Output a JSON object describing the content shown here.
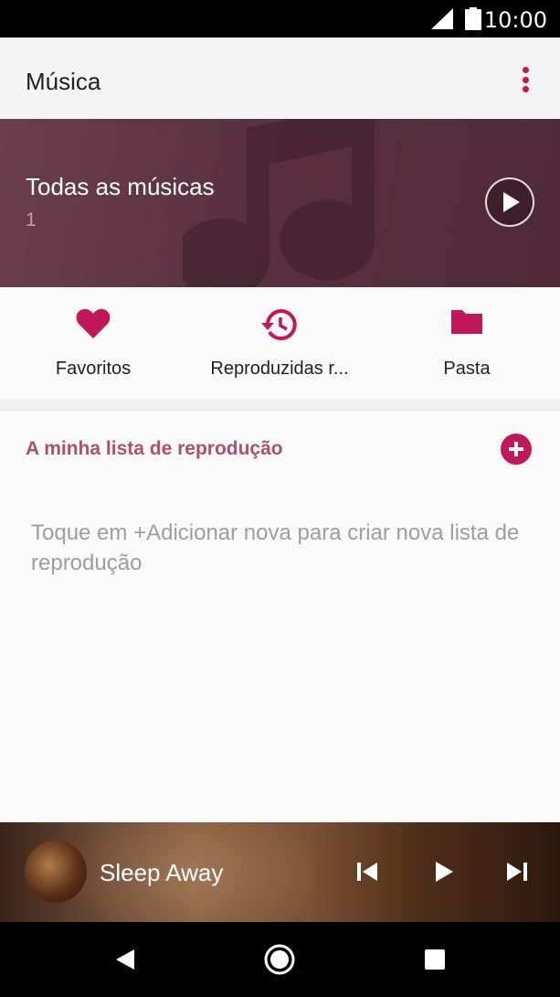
{
  "status_bar": {
    "time": "10:00"
  },
  "app_bar": {
    "title": "Música",
    "menu_icon": "more-vert-icon"
  },
  "hero": {
    "title": "Todas as músicas",
    "count": "1",
    "play_icon": "play-icon"
  },
  "quick_links": [
    {
      "label": "Favoritos",
      "icon": "heart-icon",
      "color": "#c2185b"
    },
    {
      "label": "Reproduzidas r...",
      "icon": "history-icon",
      "color": "#c2185b"
    },
    {
      "label": "Pasta",
      "icon": "folder-icon",
      "color": "#c2185b"
    }
  ],
  "playlist": {
    "title": "A minha lista de reprodução",
    "hint": "Toque em +Adicionar nova para criar nova lista de reprodução",
    "add_icon": "add-circle-icon"
  },
  "mini_player": {
    "song": "Sleep Away"
  },
  "colors": {
    "accent": "#c2185b",
    "section_title": "#ad4f70"
  }
}
